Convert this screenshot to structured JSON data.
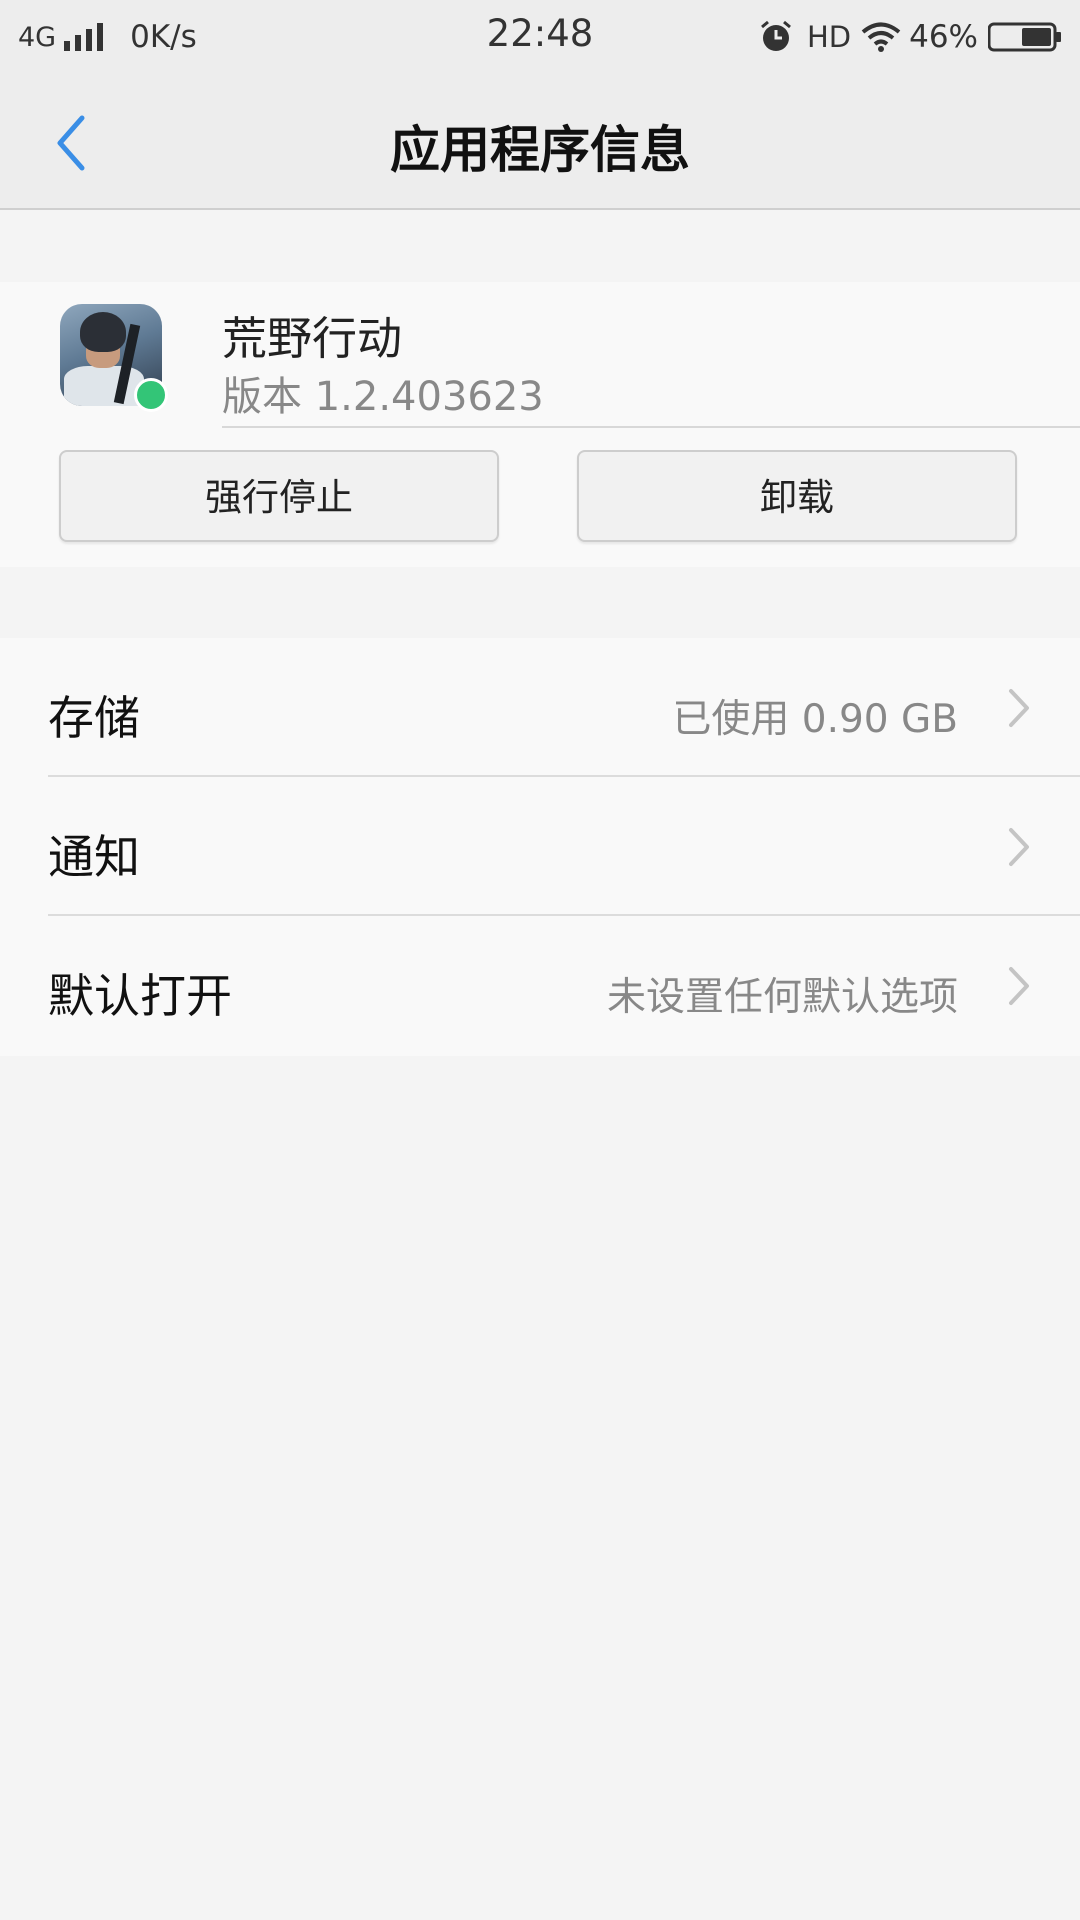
{
  "status_bar": {
    "network": "4G",
    "speed": "0K/s",
    "time": "22:48",
    "hd": "HD",
    "battery": "46%"
  },
  "nav": {
    "title": "应用程序信息",
    "back_icon": "chevron-left-icon"
  },
  "app": {
    "name": "荒野行动",
    "version": "版本 1.2.403623",
    "force_stop_label": "强行停止",
    "uninstall_label": "卸载"
  },
  "settings": {
    "items": [
      {
        "label": "存储",
        "value": "已使用 0.90 GB"
      },
      {
        "label": "通知",
        "value": ""
      },
      {
        "label": "默认打开",
        "value": "未设置任何默认选项"
      }
    ]
  },
  "colors": {
    "accent": "#3a8ee6",
    "background": "#f4f4f4",
    "card": "#f9f9f9",
    "bar": "#ededed"
  }
}
